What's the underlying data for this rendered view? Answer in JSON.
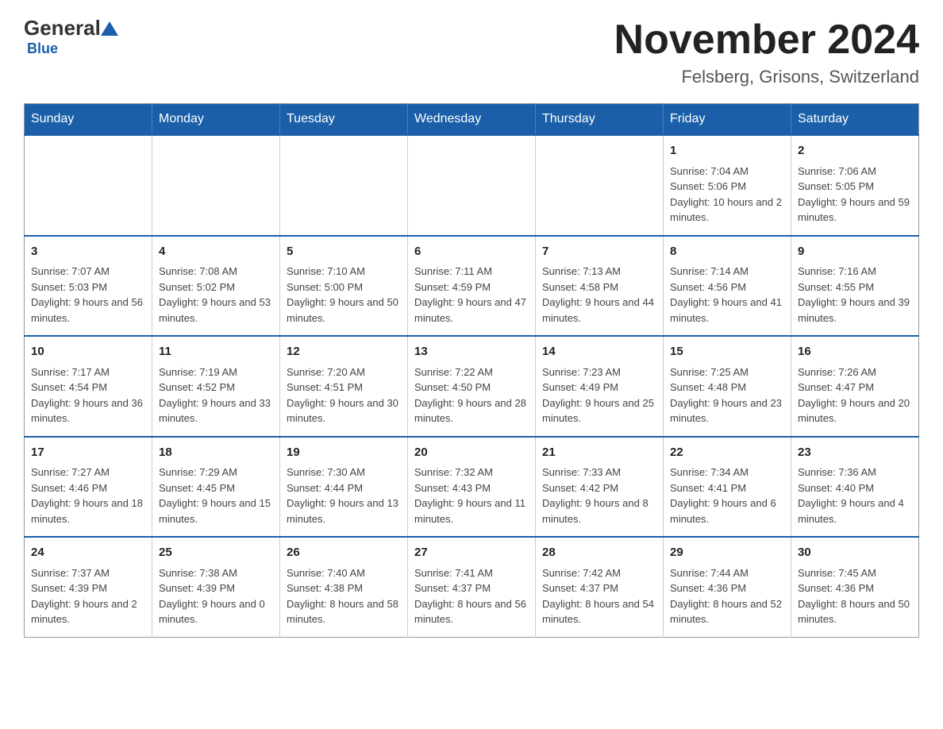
{
  "header": {
    "logo": {
      "general": "General",
      "blue": "Blue",
      "subtitle": "Blue"
    },
    "title": "November 2024",
    "location": "Felsberg, Grisons, Switzerland"
  },
  "calendar": {
    "days_of_week": [
      "Sunday",
      "Monday",
      "Tuesday",
      "Wednesday",
      "Thursday",
      "Friday",
      "Saturday"
    ],
    "weeks": [
      {
        "days": [
          {
            "number": "",
            "info": ""
          },
          {
            "number": "",
            "info": ""
          },
          {
            "number": "",
            "info": ""
          },
          {
            "number": "",
            "info": ""
          },
          {
            "number": "",
            "info": ""
          },
          {
            "number": "1",
            "info": "Sunrise: 7:04 AM\nSunset: 5:06 PM\nDaylight: 10 hours and 2 minutes."
          },
          {
            "number": "2",
            "info": "Sunrise: 7:06 AM\nSunset: 5:05 PM\nDaylight: 9 hours and 59 minutes."
          }
        ]
      },
      {
        "days": [
          {
            "number": "3",
            "info": "Sunrise: 7:07 AM\nSunset: 5:03 PM\nDaylight: 9 hours and 56 minutes."
          },
          {
            "number": "4",
            "info": "Sunrise: 7:08 AM\nSunset: 5:02 PM\nDaylight: 9 hours and 53 minutes."
          },
          {
            "number": "5",
            "info": "Sunrise: 7:10 AM\nSunset: 5:00 PM\nDaylight: 9 hours and 50 minutes."
          },
          {
            "number": "6",
            "info": "Sunrise: 7:11 AM\nSunset: 4:59 PM\nDaylight: 9 hours and 47 minutes."
          },
          {
            "number": "7",
            "info": "Sunrise: 7:13 AM\nSunset: 4:58 PM\nDaylight: 9 hours and 44 minutes."
          },
          {
            "number": "8",
            "info": "Sunrise: 7:14 AM\nSunset: 4:56 PM\nDaylight: 9 hours and 41 minutes."
          },
          {
            "number": "9",
            "info": "Sunrise: 7:16 AM\nSunset: 4:55 PM\nDaylight: 9 hours and 39 minutes."
          }
        ]
      },
      {
        "days": [
          {
            "number": "10",
            "info": "Sunrise: 7:17 AM\nSunset: 4:54 PM\nDaylight: 9 hours and 36 minutes."
          },
          {
            "number": "11",
            "info": "Sunrise: 7:19 AM\nSunset: 4:52 PM\nDaylight: 9 hours and 33 minutes."
          },
          {
            "number": "12",
            "info": "Sunrise: 7:20 AM\nSunset: 4:51 PM\nDaylight: 9 hours and 30 minutes."
          },
          {
            "number": "13",
            "info": "Sunrise: 7:22 AM\nSunset: 4:50 PM\nDaylight: 9 hours and 28 minutes."
          },
          {
            "number": "14",
            "info": "Sunrise: 7:23 AM\nSunset: 4:49 PM\nDaylight: 9 hours and 25 minutes."
          },
          {
            "number": "15",
            "info": "Sunrise: 7:25 AM\nSunset: 4:48 PM\nDaylight: 9 hours and 23 minutes."
          },
          {
            "number": "16",
            "info": "Sunrise: 7:26 AM\nSunset: 4:47 PM\nDaylight: 9 hours and 20 minutes."
          }
        ]
      },
      {
        "days": [
          {
            "number": "17",
            "info": "Sunrise: 7:27 AM\nSunset: 4:46 PM\nDaylight: 9 hours and 18 minutes."
          },
          {
            "number": "18",
            "info": "Sunrise: 7:29 AM\nSunset: 4:45 PM\nDaylight: 9 hours and 15 minutes."
          },
          {
            "number": "19",
            "info": "Sunrise: 7:30 AM\nSunset: 4:44 PM\nDaylight: 9 hours and 13 minutes."
          },
          {
            "number": "20",
            "info": "Sunrise: 7:32 AM\nSunset: 4:43 PM\nDaylight: 9 hours and 11 minutes."
          },
          {
            "number": "21",
            "info": "Sunrise: 7:33 AM\nSunset: 4:42 PM\nDaylight: 9 hours and 8 minutes."
          },
          {
            "number": "22",
            "info": "Sunrise: 7:34 AM\nSunset: 4:41 PM\nDaylight: 9 hours and 6 minutes."
          },
          {
            "number": "23",
            "info": "Sunrise: 7:36 AM\nSunset: 4:40 PM\nDaylight: 9 hours and 4 minutes."
          }
        ]
      },
      {
        "days": [
          {
            "number": "24",
            "info": "Sunrise: 7:37 AM\nSunset: 4:39 PM\nDaylight: 9 hours and 2 minutes."
          },
          {
            "number": "25",
            "info": "Sunrise: 7:38 AM\nSunset: 4:39 PM\nDaylight: 9 hours and 0 minutes."
          },
          {
            "number": "26",
            "info": "Sunrise: 7:40 AM\nSunset: 4:38 PM\nDaylight: 8 hours and 58 minutes."
          },
          {
            "number": "27",
            "info": "Sunrise: 7:41 AM\nSunset: 4:37 PM\nDaylight: 8 hours and 56 minutes."
          },
          {
            "number": "28",
            "info": "Sunrise: 7:42 AM\nSunset: 4:37 PM\nDaylight: 8 hours and 54 minutes."
          },
          {
            "number": "29",
            "info": "Sunrise: 7:44 AM\nSunset: 4:36 PM\nDaylight: 8 hours and 52 minutes."
          },
          {
            "number": "30",
            "info": "Sunrise: 7:45 AM\nSunset: 4:36 PM\nDaylight: 8 hours and 50 minutes."
          }
        ]
      }
    ]
  }
}
